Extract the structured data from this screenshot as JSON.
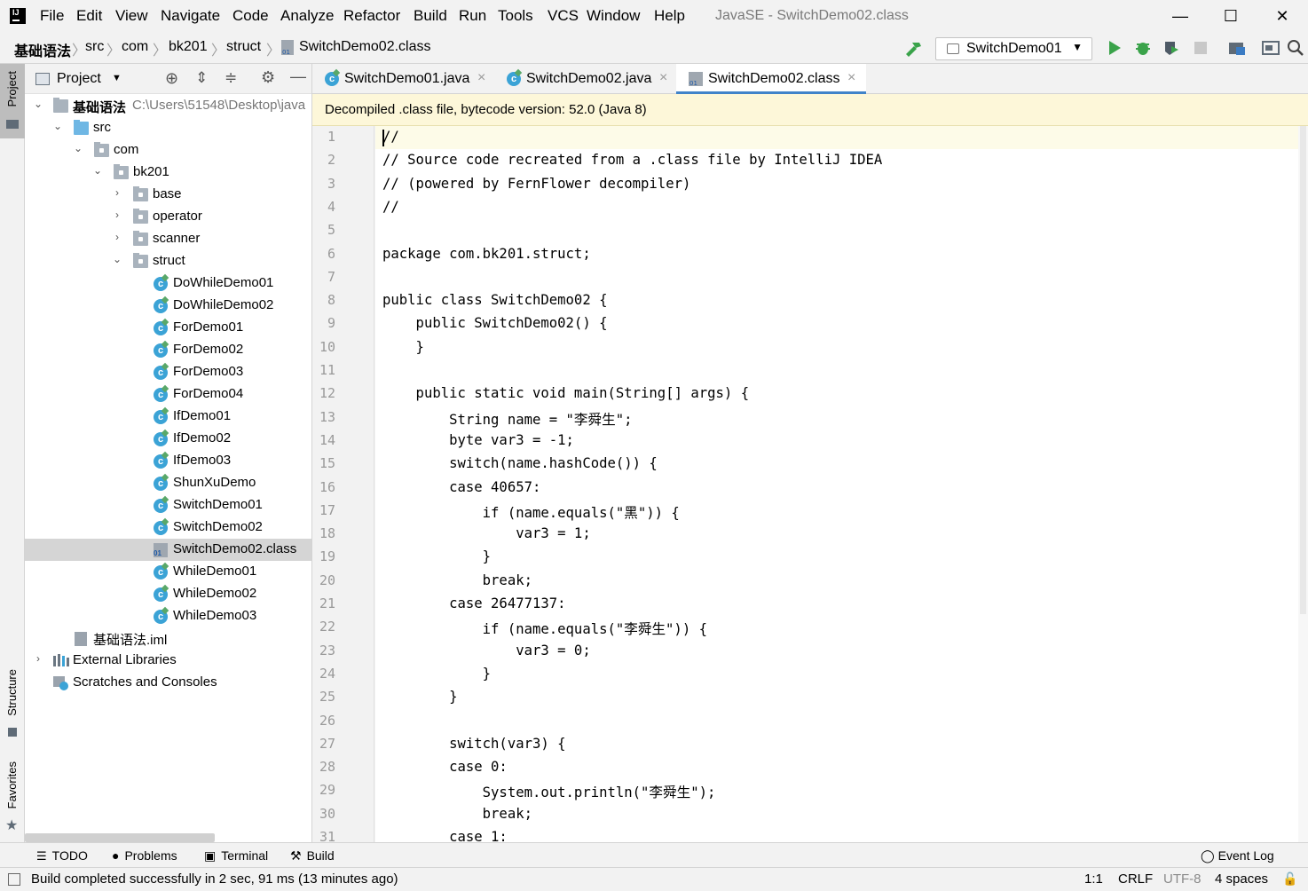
{
  "menubar": {
    "items": [
      "File",
      "Edit",
      "View",
      "Navigate",
      "Code",
      "Analyze",
      "Refactor",
      "Build",
      "Run",
      "Tools",
      "VCS",
      "Window",
      "Help"
    ],
    "window_title": "JavaSE - SwitchDemo02.class",
    "minimize": "—",
    "maximize": "☐",
    "close": "✕"
  },
  "breadcrumb": [
    "基础语法",
    "src",
    "com",
    "bk201",
    "struct",
    "SwitchDemo02.class"
  ],
  "run_config": {
    "label": "SwitchDemo01"
  },
  "side_tabs": {
    "project": "Project",
    "structure": "Structure",
    "favorites": "Favorites"
  },
  "project": {
    "title": "Project",
    "tree": [
      {
        "label": "基础语法",
        "path": "C:\\Users\\51548\\Desktop\\java",
        "bold": true
      },
      {
        "label": "src"
      },
      {
        "label": "com"
      },
      {
        "label": "bk201"
      },
      {
        "label": "base"
      },
      {
        "label": "operator"
      },
      {
        "label": "scanner"
      },
      {
        "label": "struct"
      },
      {
        "label": "DoWhileDemo01"
      },
      {
        "label": "DoWhileDemo02"
      },
      {
        "label": "ForDemo01"
      },
      {
        "label": "ForDemo02"
      },
      {
        "label": "ForDemo03"
      },
      {
        "label": "ForDemo04"
      },
      {
        "label": "IfDemo01"
      },
      {
        "label": "IfDemo02"
      },
      {
        "label": "IfDemo03"
      },
      {
        "label": "ShunXuDemo"
      },
      {
        "label": "SwitchDemo01"
      },
      {
        "label": "SwitchDemo02"
      },
      {
        "label": "SwitchDemo02.class"
      },
      {
        "label": "WhileDemo01"
      },
      {
        "label": "WhileDemo02"
      },
      {
        "label": "WhileDemo03"
      },
      {
        "label": "基础语法.iml"
      },
      {
        "label": "External Libraries"
      },
      {
        "label": "Scratches and Consoles"
      }
    ]
  },
  "editor": {
    "tabs": [
      {
        "label": "SwitchDemo01.java"
      },
      {
        "label": "SwitchDemo02.java"
      },
      {
        "label": "SwitchDemo02.class"
      }
    ],
    "active_tab": "SwitchDemo02.class",
    "banner": "Decompiled .class file, bytecode version: 52.0 (Java 8)",
    "line_numbers": [
      "1",
      "2",
      "3",
      "4",
      "5",
      "6",
      "7",
      "8",
      "9",
      "10",
      "11",
      "12",
      "13",
      "14",
      "15",
      "16",
      "17",
      "18",
      "19",
      "20",
      "21",
      "22",
      "23",
      "24",
      "25",
      "26",
      "27",
      "28",
      "29",
      "30",
      "31"
    ],
    "lines": [
      "//",
      "// Source code recreated from a .class file by IntelliJ IDEA",
      "// (powered by FernFlower decompiler)",
      "//",
      "",
      "package com.bk201.struct;",
      "",
      "public class SwitchDemo02 {",
      "    public SwitchDemo02() {",
      "    }",
      "",
      "    public static void main(String[] args) {",
      "        String name = \"李舜生\";",
      "        byte var3 = -1;",
      "        switch(name.hashCode()) {",
      "        case 40657:",
      "            if (name.equals(\"黑\")) {",
      "                var3 = 1;",
      "            }",
      "            break;",
      "        case 26477137:",
      "            if (name.equals(\"李舜生\")) {",
      "                var3 = 0;",
      "            }",
      "        }",
      "",
      "        switch(var3) {",
      "        case 0:",
      "            System.out.println(\"李舜生\");",
      "            break;",
      "        case 1:"
    ]
  },
  "tool_windows": [
    "TODO",
    "Problems",
    "Terminal",
    "Build"
  ],
  "event_log": "Event Log",
  "status": {
    "message": "Build completed successfully in 2 sec, 91 ms (13 minutes ago)",
    "position": "1:1",
    "line_sep": "CRLF",
    "encoding": "UTF-8",
    "indent": "4 spaces"
  },
  "colors": {
    "accent": "#4083c9",
    "banner_bg": "#fdf7d9",
    "selection": "#d5d5d5",
    "run_green": "#3aa34a"
  }
}
